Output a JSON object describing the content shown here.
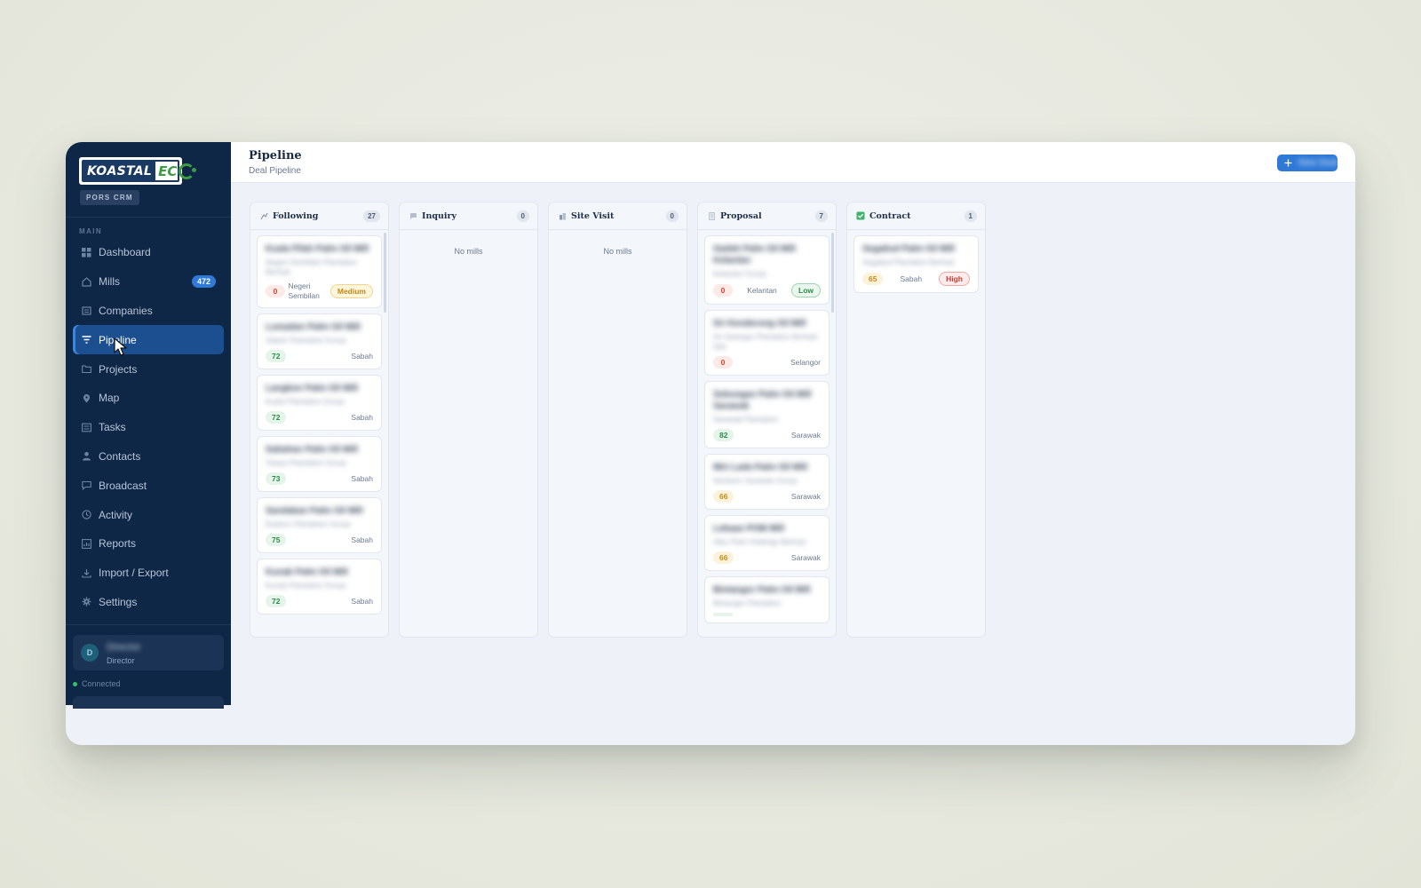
{
  "brand": {
    "logo_part_a": "KOASTAL",
    "logo_part_b": "EC",
    "app_badge": "PORS CRM"
  },
  "sidebar": {
    "section_label": "MAIN",
    "items": [
      {
        "label": "Dashboard",
        "icon": "grid-icon"
      },
      {
        "label": "Mills",
        "icon": "home-icon",
        "badge": "472"
      },
      {
        "label": "Companies",
        "icon": "building-icon"
      },
      {
        "label": "Pipeline",
        "icon": "filter-icon",
        "active": true
      },
      {
        "label": "Projects",
        "icon": "folder-icon"
      },
      {
        "label": "Map",
        "icon": "map-pin-icon"
      },
      {
        "label": "Tasks",
        "icon": "list-icon"
      },
      {
        "label": "Contacts",
        "icon": "user-icon"
      },
      {
        "label": "Broadcast",
        "icon": "message-icon"
      },
      {
        "label": "Activity",
        "icon": "clock-icon"
      },
      {
        "label": "Reports",
        "icon": "chart-icon"
      },
      {
        "label": "Import / Export",
        "icon": "download-icon"
      },
      {
        "label": "Settings",
        "icon": "gear-icon"
      }
    ],
    "user": {
      "initial": "D",
      "name": "Director",
      "role": "Director"
    },
    "connection": "Connected"
  },
  "header": {
    "title": "Pipeline",
    "subtitle": "Deal Pipeline",
    "new_button": "+ New Deal"
  },
  "columns": [
    {
      "name": "Following",
      "count": "27",
      "cards": [
        {
          "title": "Kuala Pilah Palm Oil Mill",
          "sub": "Negeri Sembilan Plantation Berhad",
          "score": "0",
          "score_color": "red",
          "region": "Negeri Sembilan",
          "priority": "Medium"
        },
        {
          "title": "Lumadan Palm Oil Mill",
          "sub": "Sabah Plantation Group",
          "score": "72",
          "score_color": "green",
          "region": "Sabah"
        },
        {
          "title": "Langkon Palm Oil Mill",
          "sub": "Kudat Plantation Group",
          "score": "72",
          "score_color": "green",
          "region": "Sabah"
        },
        {
          "title": "Sabahan Palm Oil Mill",
          "sub": "Tawau Plantation Group",
          "score": "73",
          "score_color": "green",
          "region": "Sabah"
        },
        {
          "title": "Sandakan Palm Oil Mill",
          "sub": "Eastern Plantation Group",
          "score": "75",
          "score_color": "green",
          "region": "Sabah"
        },
        {
          "title": "Kunak Palm Oil Mill",
          "sub": "Kunak Plantation Group",
          "score": "72",
          "score_color": "green",
          "region": "Sabah"
        }
      ]
    },
    {
      "name": "Inquiry",
      "count": "0",
      "empty_text": "No mills",
      "cards": []
    },
    {
      "name": "Site Visit",
      "count": "0",
      "empty_text": "No mills",
      "cards": []
    },
    {
      "name": "Proposal",
      "count": "7",
      "cards": [
        {
          "title": "Gadek Palm Oil Mill Kelantan",
          "sub": "Kelantan Group",
          "score": "0",
          "score_color": "red",
          "region": "Kelantan",
          "priority": "Low"
        },
        {
          "title": "Sri Kenderong Oil Mill",
          "sub": "Sri Selangor Plantation Berhad Sdn",
          "score": "0",
          "score_color": "red",
          "region": "Selangor"
        },
        {
          "title": "Sebungan Palm Oil Mill Sarawak",
          "sub": "Sarawak Plantation",
          "score": "82",
          "score_color": "green",
          "region": "Sarawak"
        },
        {
          "title": "Miri Lada Palm Oil Mill",
          "sub": "Northern Sarawak Group",
          "score": "66",
          "score_color": "yellow",
          "region": "Sarawak"
        },
        {
          "title": "Lebaan POM Mill",
          "sub": "Sibu Palm Holdings Berhad",
          "score": "66",
          "score_color": "yellow",
          "region": "Sarawak"
        },
        {
          "title": "Bintangor Palm Oil Mill",
          "sub": "Bintangor Plantation",
          "score": "",
          "score_color": "green",
          "region": ""
        }
      ]
    },
    {
      "name": "Contract",
      "count": "1",
      "cards": [
        {
          "title": "Segaliud Palm Oil Mill",
          "sub": "Segaliud Plantation Berhad",
          "score": "65",
          "score_color": "yellow",
          "region": "Sabah",
          "priority": "High"
        }
      ]
    }
  ],
  "colors": {
    "sidebar_bg": "#0f2747",
    "active_nav": "#1b4f8f",
    "accent": "#2f79d6",
    "board_bg": "#eef2f8"
  }
}
